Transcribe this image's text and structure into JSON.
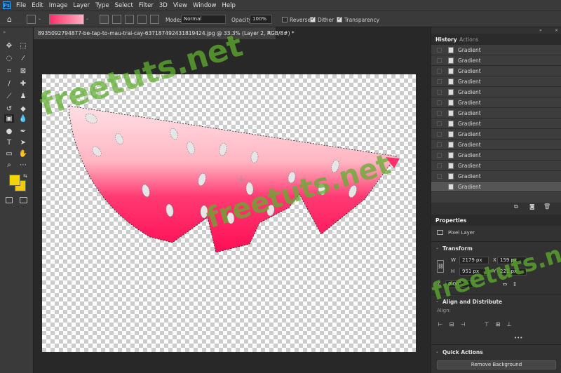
{
  "menu": [
    "File",
    "Edit",
    "Image",
    "Layer",
    "Type",
    "Select",
    "Filter",
    "3D",
    "View",
    "Window",
    "Help"
  ],
  "app_logo": "Ps",
  "options": {
    "mode_label": "Mode:",
    "mode_value": "Normal",
    "opacity_label": "Opacity:",
    "opacity_value": "100%",
    "reverse_label": "Reverse",
    "dither_label": "Dither",
    "transparency_label": "Transparency",
    "reverse_checked": false,
    "dither_checked": true,
    "transparency_checked": true
  },
  "document_tab": {
    "title": "8935092794877-be-tap-to-mau-trai-cay-637187492431819424.jpg @ 33.3% (Layer 2, RGB/8#) *",
    "close": "×"
  },
  "history_panel": {
    "tabs": [
      "History",
      "Actions"
    ],
    "items": [
      "Gradient",
      "Gradient",
      "Gradient",
      "Gradient",
      "Gradient",
      "Gradient",
      "Gradient",
      "Gradient",
      "Gradient",
      "Gradient",
      "Gradient",
      "Gradient",
      "Gradient",
      "Gradient"
    ]
  },
  "properties_panel": {
    "tab": "Properties",
    "layer_type": "Pixel Layer",
    "transform_title": "Transform",
    "w_label": "W",
    "w_value": "2179 px",
    "h_label": "H",
    "h_value": "951 px",
    "x_label": "X",
    "x_value": "159 px",
    "y_label": "Y",
    "y_value": "221 px",
    "angle_value": "0.00°",
    "align_title": "Align and Distribute",
    "align_sub": "Align:",
    "more": "•••",
    "quick_actions_title": "Quick Actions",
    "remove_bg_label": "Remove Background"
  },
  "colors": {
    "foreground": "#f6d400",
    "background": "#f6c800",
    "gradient_start": "#ffb6c3",
    "gradient_end": "#ff1c5e",
    "fruit_pink": "#ff1a5b"
  },
  "watermark": "freetuts.net",
  "icons": [
    "home-icon",
    "move-icon",
    "marquee-icon",
    "lasso-icon",
    "magic-wand-icon",
    "crop-icon",
    "frame-icon",
    "eyedropper-icon",
    "healing-icon",
    "brush-icon",
    "stamp-icon",
    "history-brush-icon",
    "eraser-icon",
    "gradient-icon",
    "blur-icon",
    "dodge-icon",
    "pen-icon",
    "type-icon",
    "path-select-icon",
    "rectangle-icon",
    "hand-icon",
    "zoom-icon",
    "more-icon"
  ]
}
